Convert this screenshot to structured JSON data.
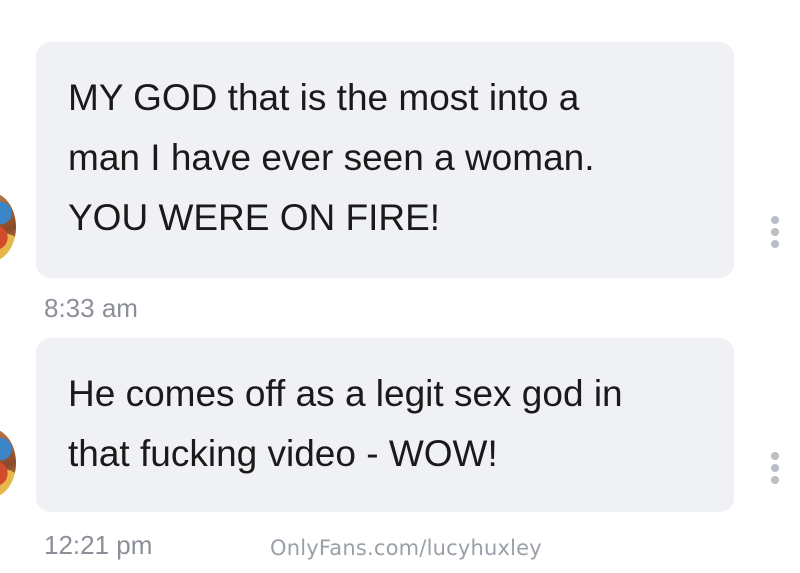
{
  "messages": [
    {
      "lines": [
        "MY GOD that is the most into a",
        "man I have ever seen a woman.",
        "YOU WERE ON FIRE!"
      ],
      "time": "8:33 am"
    },
    {
      "lines": [
        "He comes off as a legit sex god in",
        "that fucking video - WOW!"
      ],
      "time": "12:21 pm"
    }
  ],
  "watermark": "OnlyFans.com/lucyhuxley",
  "icons": {
    "avatar": "avatar",
    "more": "more-vertical-icon"
  }
}
